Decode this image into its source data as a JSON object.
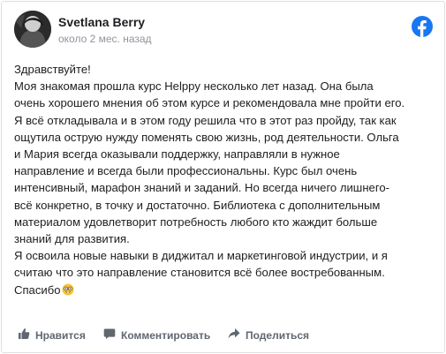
{
  "post": {
    "author": "Svetlana Berry",
    "time": "около 2 мес. назад",
    "lines": [
      "Здравствуйте!",
      "Моя знакомая прошла курс Helppy несколько лет назад. Она была",
      "очень хорошего мнения об этом курсе и рекомендовала мне пройти его.",
      "Я всё откладывала и в этом году решила что в этот раз пройду, так как",
      "ощутила острую нужду поменять свою жизнь, род деятельности. Ольга",
      "и Мария всегда оказывали поддержку, направляли в нужное",
      "направление и всегда были профессиональны. Курс был очень",
      "интенсивный, марафон знаний и заданий. Но всегда ничего лишнего-",
      "всё конкретно, в точку и достаточно. Библиотека с дополнительным",
      "материалом удовлетворит потребность любого кто жаждит больше",
      "знаний для развития.",
      "Я освоила новые навыки в диджитал и маркетинговой индустрии, и я",
      "считаю что это направление становится всё более востребованным.",
      "Спасибо"
    ],
    "emoji": "nerd-face-emoji"
  },
  "actions": {
    "like": "Нравится",
    "comment": "Комментировать",
    "share": "Поделиться"
  },
  "icons": {
    "platform": "facebook-icon",
    "like": "thumbs-up-icon",
    "comment": "comment-bubble-icon",
    "share": "share-arrow-icon"
  },
  "colors": {
    "facebook_blue": "#1877f2",
    "action_gray": "#606770",
    "meta_gray": "#90949c",
    "text": "#1c1e21"
  }
}
